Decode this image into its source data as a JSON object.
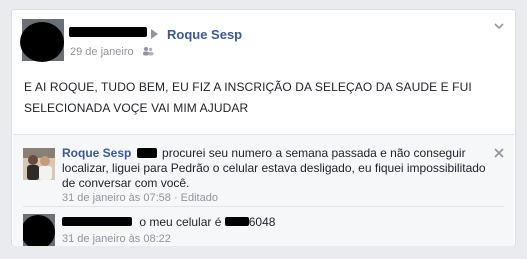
{
  "post": {
    "recipient": "Roque Sesp",
    "date": "29 de janeiro",
    "audience_icon": "people-icon",
    "options_icon": "chevron-down-icon",
    "text": "E AI ROQUE, TUDO BEM, EU FIZ A INSCRIÇÃO DA SELEÇAO DA SAUDE E FUI SELECIONADA VOÇE VAI MIM AJUDAR"
  },
  "comments": [
    {
      "author": "Roque Sesp",
      "text": "procurei seu numero a semana passada e não conseguir localizar, liguei para Pedrão o celular estava desligado, eu fiquei impossibilitado de conversar com você.",
      "timestamp": "31 de janeiro às 07:58",
      "edited": "· Editado",
      "close_icon": "close-icon"
    },
    {
      "text_prefix": "o meu celular é",
      "text_suffix": "6048",
      "timestamp": "31 de janeiro às 08:22"
    }
  ]
}
